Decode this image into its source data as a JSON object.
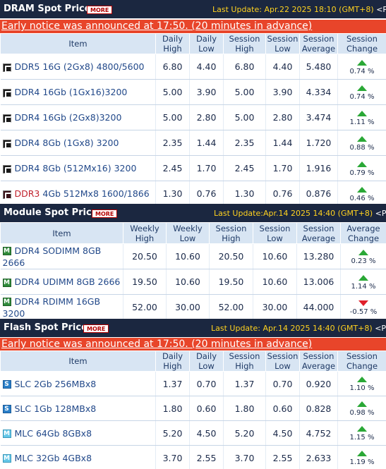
{
  "dram": {
    "title": "DRAM Spot Price",
    "more": "MORE",
    "last_update": "Last Update: Apr.22 2025 18:10 (GMT+8)",
    "price_link": "<Price",
    "notice": "Early notice was announced at 17:50. (20 minutes in advance)",
    "headers": [
      "Item",
      "Daily High",
      "Daily Low",
      "Session High",
      "Session Low",
      "Session Average",
      "Session Change"
    ],
    "rows": [
      {
        "prefix": "",
        "item": "DDR5 16G (2Gx8) 4800/5600",
        "c1": "6.80",
        "c2": "4.40",
        "c3": "6.80",
        "c4": "4.40",
        "c5": "5.480",
        "change": "0.74 %",
        "dir": "up"
      },
      {
        "prefix": "",
        "item": "DDR4 16Gb (1Gx16)3200",
        "c1": "5.00",
        "c2": "3.90",
        "c3": "5.00",
        "c4": "3.90",
        "c5": "4.334",
        "change": "0.74 %",
        "dir": "up"
      },
      {
        "prefix": "",
        "item": "DDR4 16Gb (2Gx8)3200",
        "c1": "5.00",
        "c2": "2.80",
        "c3": "5.00",
        "c4": "2.80",
        "c5": "3.474",
        "change": "1.11 %",
        "dir": "up"
      },
      {
        "prefix": "",
        "item": "DDR4 8Gb (1Gx8) 3200",
        "c1": "2.35",
        "c2": "1.44",
        "c3": "2.35",
        "c4": "1.44",
        "c5": "1.720",
        "change": "0.88 %",
        "dir": "up"
      },
      {
        "prefix": "",
        "item": "DDR4 8Gb (512Mx16) 3200",
        "c1": "2.45",
        "c2": "1.70",
        "c3": "2.45",
        "c4": "1.70",
        "c5": "1.916",
        "change": "0.79 %",
        "dir": "up"
      },
      {
        "prefix": "DDR3",
        "item": " 4Gb 512Mx8 1600/1866",
        "c1": "1.30",
        "c2": "0.76",
        "c3": "1.30",
        "c4": "0.76",
        "c5": "0.876",
        "change": "0.46 %",
        "dir": "up"
      }
    ],
    "icon": "chip-icon"
  },
  "module": {
    "title": "Module Spot Price",
    "more": "MORE",
    "last_update": "Last Update:Apr.14 2025 14:40 (GMT+8)",
    "price_link": "<Price",
    "headers": [
      "Item",
      "Weekly High",
      "Weekly Low",
      "Session High",
      "Session Low",
      "Session Average",
      "Average Change"
    ],
    "rows": [
      {
        "item": "DDR4 SODIMM 8GB 2666",
        "c1": "20.50",
        "c2": "10.60",
        "c3": "20.50",
        "c4": "10.60",
        "c5": "13.280",
        "change": "0.23 %",
        "dir": "up"
      },
      {
        "item": "DDR4 UDIMM 8GB 2666",
        "c1": "19.50",
        "c2": "10.60",
        "c3": "19.50",
        "c4": "10.60",
        "c5": "13.006",
        "change": "1.14 %",
        "dir": "up"
      },
      {
        "item": "DDR4 RDIMM 16GB 3200",
        "c1": "52.00",
        "c2": "30.00",
        "c3": "52.00",
        "c4": "30.00",
        "c5": "44.000",
        "change": "-0.57 %",
        "dir": "down"
      }
    ],
    "icon": "module-icon",
    "icon_letter": "M"
  },
  "flash": {
    "title": "Flash Spot Price",
    "more": "MORE",
    "last_update": "Last Update: Apr.14 2025 14:40 (GMT+8)",
    "price_link": "<Price",
    "notice": "Early notice was announced at 17:50. (20 minutes in advance)",
    "headers": [
      "Item",
      "Daily High",
      "Daily Low",
      "Session High",
      "Session Low",
      "Session Average",
      "Session Change"
    ],
    "rows": [
      {
        "type": "slc",
        "letter": "S",
        "item": "SLC 2Gb 256MBx8",
        "c1": "1.37",
        "c2": "0.70",
        "c3": "1.37",
        "c4": "0.70",
        "c5": "0.920",
        "change": "1.10 %",
        "dir": "up"
      },
      {
        "type": "slc",
        "letter": "S",
        "item": "SLC 1Gb 128MBx8",
        "c1": "1.80",
        "c2": "0.60",
        "c3": "1.80",
        "c4": "0.60",
        "c5": "0.828",
        "change": "0.98 %",
        "dir": "up"
      },
      {
        "type": "mlc",
        "letter": "M",
        "item": "MLC 64Gb 8GBx8",
        "c1": "5.20",
        "c2": "4.50",
        "c3": "5.20",
        "c4": "4.50",
        "c5": "4.752",
        "change": "1.15 %",
        "dir": "up"
      },
      {
        "type": "mlc",
        "letter": "M",
        "item": "MLC 32Gb 4GBx8",
        "c1": "3.70",
        "c2": "2.55",
        "c3": "3.70",
        "c4": "2.55",
        "c5": "2.633",
        "change": "1.19 %",
        "dir": "up"
      }
    ]
  },
  "colors": {
    "header_bg": "#1b2740",
    "notice_bg": "#e8452a",
    "th_bg": "#d8e5f3",
    "up": "#2aa836",
    "down": "#e0202b",
    "update_text": "#ffd21f"
  }
}
